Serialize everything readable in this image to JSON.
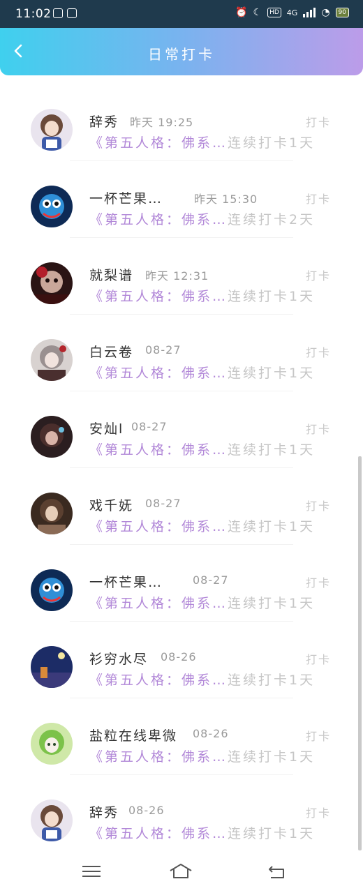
{
  "status": {
    "time": "11:02",
    "hd": "HD",
    "network": "4G",
    "battery": "90"
  },
  "header": {
    "title": "日常打卡"
  },
  "checkins": [
    {
      "name": "辞秀",
      "time": "昨天 19:25",
      "tag": "打卡",
      "book": "《第五人格：佛系…",
      "streak": "连续打卡1天",
      "avatar": "brown-hair-girl"
    },
    {
      "name": "一杯芒果…",
      "time": "昨天 15:30",
      "tag": "打卡",
      "book": "《第五人格：佛系…",
      "streak": "连续打卡2天",
      "avatar": "blue-goggles-character"
    },
    {
      "name": "就梨谱",
      "time": "昨天 12:31",
      "tag": "打卡",
      "book": "《第五人格：佛系…",
      "streak": "连续打卡1天",
      "avatar": "dark-doll-character"
    },
    {
      "name": "白云卷",
      "time": "08-27",
      "tag": "打卡",
      "book": "《第五人格：佛系…",
      "streak": "连续打卡1天",
      "avatar": "grey-hair-character"
    },
    {
      "name": "安灿l",
      "time": "08-27",
      "tag": "打卡",
      "book": "《第五人格：佛系…",
      "streak": "连续打卡1天",
      "avatar": "dark-anime-girl"
    },
    {
      "name": "戏千妩",
      "time": "08-27",
      "tag": "打卡",
      "book": "《第五人格：佛系…",
      "streak": "连续打卡1天",
      "avatar": "sepia-girl"
    },
    {
      "name": "一杯芒果…",
      "time": "08-27",
      "tag": "打卡",
      "book": "《第五人格：佛系…",
      "streak": "连续打卡1天",
      "avatar": "blue-goggles-character"
    },
    {
      "name": "衫穷水尽",
      "time": "08-26",
      "tag": "打卡",
      "book": "《第五人格：佛系…",
      "streak": "连续打卡1天",
      "avatar": "night-scene"
    },
    {
      "name": "盐粒在线卑微",
      "time": "08-26",
      "tag": "打卡",
      "book": "《第五人格：佛系…",
      "streak": "连续打卡1天",
      "avatar": "green-hood-character"
    },
    {
      "name": "辞秀",
      "time": "08-26",
      "tag": "打卡",
      "book": "《第五人格：佛系…",
      "streak": "连续打卡1天",
      "avatar": "brown-hair-girl"
    }
  ],
  "colors": {
    "header_start": "#3fd0ee",
    "header_end": "#bc9ce9",
    "book_text": "#b288d8",
    "streak_text": "#c6c6c6",
    "status_bar": "#1f3a4d"
  }
}
